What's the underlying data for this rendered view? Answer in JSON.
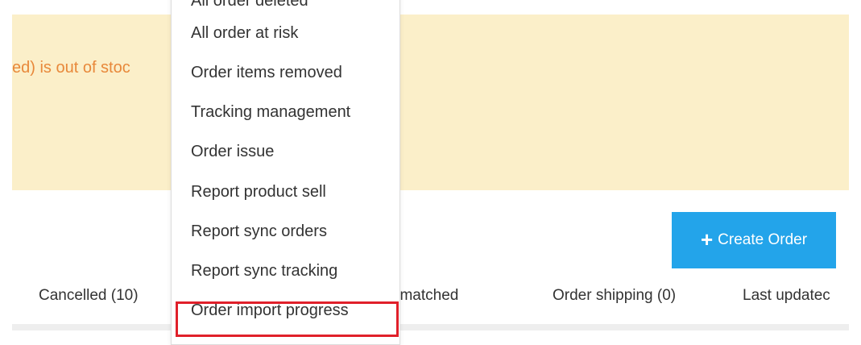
{
  "alert": {
    "text": "ed) is out of stoc"
  },
  "toolbar": {
    "create_label": "Create Order",
    "create_icon": "plus-icon"
  },
  "tabs": [
    {
      "label": "Cancelled (10)"
    },
    {
      "label": "er Unmatched"
    },
    {
      "label": "Order shipping (0)"
    },
    {
      "label": "Last updatec"
    }
  ],
  "menu": {
    "items": [
      {
        "label": "All order deleted"
      },
      {
        "label": "All order at risk"
      },
      {
        "label": "Order items removed"
      },
      {
        "label": "Tracking management"
      },
      {
        "label": "Order issue"
      },
      {
        "label": "Report product sell"
      },
      {
        "label": "Report sync orders"
      },
      {
        "label": "Report sync tracking"
      },
      {
        "label": "Order import progress",
        "highlighted": true
      }
    ]
  },
  "colors": {
    "alert_bg": "#fbefc9",
    "alert_text": "#e8883a",
    "button_bg": "#23a4ea",
    "highlight_border": "#e0202a"
  }
}
